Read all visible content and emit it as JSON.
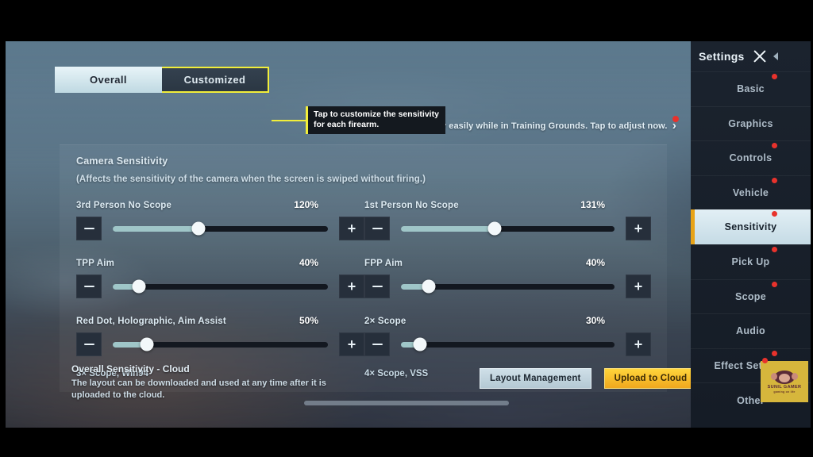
{
  "app": {
    "tabs": [
      {
        "label": "Overall",
        "active": true
      },
      {
        "label": "Customized",
        "active": false,
        "highlighted": true
      }
    ],
    "tooltip": "Tap to customize the sensitivity for each firearm.",
    "banner": {
      "text": "Adjust sensitivity easily while in Training Grounds. Tap to adjust now.",
      "chevron": "›"
    }
  },
  "section": {
    "title": "Camera Sensitivity",
    "subtitle": "(Affects the sensitivity of the camera when the screen is swiped without firing.)"
  },
  "sliders": [
    {
      "label": "3rd Person No Scope",
      "value": "120%",
      "percent": 40,
      "minus": "−",
      "plus": "+"
    },
    {
      "label": "1st Person No Scope",
      "value": "131%",
      "percent": 44,
      "minus": "−",
      "plus": "+"
    },
    {
      "label": "TPP Aim",
      "value": "40%",
      "percent": 12,
      "minus": "−",
      "plus": "+"
    },
    {
      "label": "FPP Aim",
      "value": "40%",
      "percent": 13,
      "minus": "−",
      "plus": "+"
    },
    {
      "label": "Red Dot, Holographic, Aim Assist",
      "value": "50%",
      "percent": 16,
      "minus": "−",
      "plus": "+"
    },
    {
      "label": "2× Scope",
      "value": "30%",
      "percent": 9,
      "minus": "−",
      "plus": "+"
    }
  ],
  "cut_off_labels": {
    "left": "3× Scope, Win94",
    "right": "4× Scope, VSS"
  },
  "cloud": {
    "title": "Overall Sensitivity - Cloud",
    "description": "The layout can be downloaded and used at any time after it is uploaded to the cloud.",
    "layout_button": "Layout Management",
    "upload_button": "Upload to Cloud"
  },
  "sidebar": {
    "title": "Settings",
    "items": [
      {
        "label": "Basic",
        "selected": false,
        "badge": true
      },
      {
        "label": "Graphics",
        "selected": false,
        "badge": false
      },
      {
        "label": "Controls",
        "selected": false,
        "badge": true
      },
      {
        "label": "Vehicle",
        "selected": false,
        "badge": true
      },
      {
        "label": "Sensitivity",
        "selected": true,
        "badge": true
      },
      {
        "label": "Pick Up",
        "selected": false,
        "badge": true
      },
      {
        "label": "Scope",
        "selected": false,
        "badge": true
      },
      {
        "label": "Audio",
        "selected": false,
        "badge": false
      },
      {
        "label": "Effect Settings",
        "selected": false,
        "badge": true
      },
      {
        "label": "Other",
        "selected": false,
        "badge": false
      }
    ]
  },
  "watermark": {
    "name": "SUNIL GAMER",
    "tagline": "gaming on life"
  },
  "colors": {
    "accent_yellow": "#f2ee3a",
    "badge_red": "#e8322c",
    "upload_orange": "#f0a81e",
    "slider_fill": "#9fc6c8",
    "selected_bar": "#e8a317"
  }
}
